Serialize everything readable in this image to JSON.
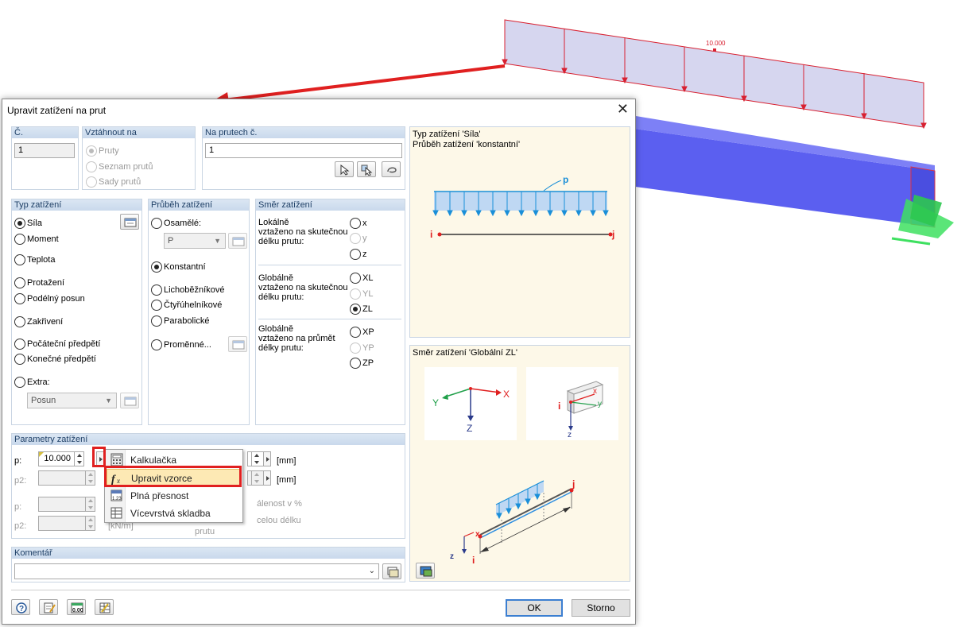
{
  "scene": {
    "load_value": "10.000"
  },
  "dialog": {
    "title": "Upravit zatížení na prut",
    "close_glyph": "✕",
    "no": {
      "label": "Č.",
      "value": "1"
    },
    "relate_to": {
      "label": "Vztáhnout na",
      "options": [
        "Pruty",
        "Seznam prutů",
        "Sady prutů"
      ],
      "selected": 0
    },
    "on_members": {
      "label": "Na prutech č.",
      "value": "1"
    },
    "load_type": {
      "label": "Typ zatížení",
      "options": [
        "Síla",
        "Moment",
        "Teplota",
        "Protažení",
        "Podélný posun",
        "Zakřivení",
        "Počáteční předpětí",
        "Konečné předpětí",
        "Extra:"
      ],
      "selected": 0,
      "extra_combo": "Posun"
    },
    "load_distribution": {
      "label": "Průběh zatížení",
      "options": [
        "Osamělé:",
        "Konstantní",
        "Lichoběžníkové",
        "Čtyřúhelníkové",
        "Parabolické",
        "Proměnné..."
      ],
      "selected": 1,
      "osamele_combo": "P"
    },
    "load_direction": {
      "label": "Směr zatížení",
      "groups": [
        {
          "text": [
            "Lokálně",
            "vztaženo na skutečnou",
            "délku prutu:"
          ],
          "options": [
            "x",
            "y",
            "z"
          ]
        },
        {
          "text": [
            "Globálně",
            "vztaženo na skutečnou",
            "délku prutu:"
          ],
          "options": [
            "XL",
            "YL",
            "ZL"
          ]
        },
        {
          "text": [
            "Globálně",
            "vztaženo na průmět",
            "délky prutu:"
          ],
          "options": [
            "XP",
            "YP",
            "ZP"
          ]
        }
      ],
      "selected": "ZL"
    },
    "parameters": {
      "label": "Parametry zatížení",
      "rows": [
        {
          "label": "p:",
          "value": "10.000",
          "unit": "[mm]"
        },
        {
          "label": "p2:",
          "value": "",
          "unit": "[mm]"
        },
        {
          "label": "p:",
          "value": ""
        },
        {
          "label": "p2:",
          "value": ""
        }
      ],
      "hidden_fragments": [
        "álenost v %",
        "celou délku",
        "[kN/m]",
        "prutu"
      ]
    },
    "comment": {
      "label": "Komentář",
      "value": ""
    },
    "preview_top": {
      "line1": "Typ zatížení 'Síla'",
      "line2": "Průběh zatížení 'konstantní'",
      "p": "p",
      "i": "i",
      "j": "j"
    },
    "preview_bottom": {
      "title": "Směr zatížení 'Globální ZL'",
      "axes": {
        "x": "X",
        "y": "Y",
        "z": "Z",
        "lx": "x",
        "ly": "y",
        "lz": "z",
        "i": "i",
        "j": "j"
      }
    },
    "buttons": {
      "ok": "OK",
      "cancel": "Storno"
    }
  },
  "context_menu": {
    "items": [
      {
        "label": "Kalkulačka",
        "icon": "calculator-icon"
      },
      {
        "label": "Upravit vzorce",
        "icon": "formula-fx-icon"
      },
      {
        "label": "Plná přesnost",
        "icon": "precision-icon"
      },
      {
        "label": "Vícevrstvá skladba",
        "icon": "layers-icon"
      }
    ],
    "highlighted": 1
  },
  "colors": {
    "accent_red": "#e02020",
    "load_fill": "#bfd8f3",
    "beam_blue": "#5b5ff0"
  }
}
